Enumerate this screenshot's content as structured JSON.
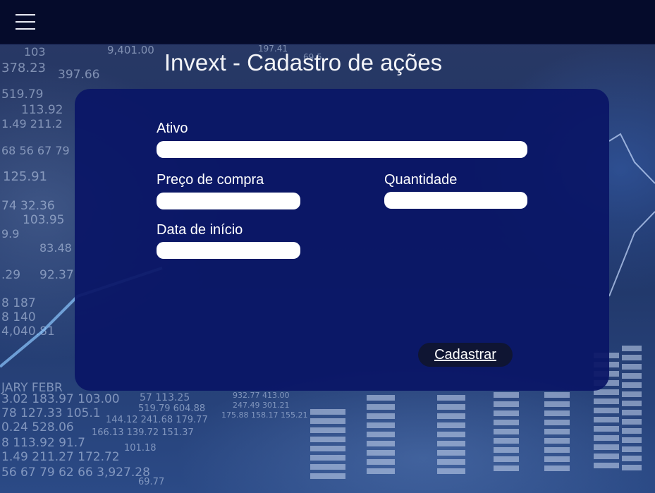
{
  "header": {
    "menu_icon": "hamburger-menu-icon"
  },
  "page": {
    "title": "Invext - Cadastro de ações"
  },
  "form": {
    "ativo": {
      "label": "Ativo",
      "value": ""
    },
    "preco": {
      "label": "Preço de compra",
      "value": ""
    },
    "quantidade": {
      "label": "Quantidade",
      "value": ""
    },
    "data": {
      "label": "Data de início",
      "value": ""
    },
    "submit_label": "Cadastrar"
  },
  "background": {
    "numbers_left": [
      "103",
      "378.23",
      "397.66",
      "519.79",
      "113.92",
      "1.49 211.2",
      "68 56 67 79",
      "125.91",
      "74 32.36",
      "103.95",
      "9.9",
      "83.48",
      ".29",
      "92.37",
      "8 187",
      "8 140",
      "4,040.81"
    ],
    "numbers_top": [
      "9,401.00",
      "197.41",
      "69.5"
    ],
    "numbers_bottom": [
      "JARY FEBR",
      "3.02 183.97 103.00",
      "78 127.33 105.1",
      "0.24 528.06",
      "8 113.92 91.7",
      "1.49 211.27 172.72",
      "56 67 79 62 66 3,927.28",
      "57 113.25",
      "519.79 604.88",
      "144.12 241.68 179.77",
      "166.13 139.72 151.37",
      "101.18",
      "932.77 413.00",
      "247.49 301.21",
      "175.88 158.17 155.21",
      "69.77"
    ],
    "colors": {
      "topbar": "#050b2b",
      "card": "#0a1666",
      "button": "#0f1533"
    }
  }
}
